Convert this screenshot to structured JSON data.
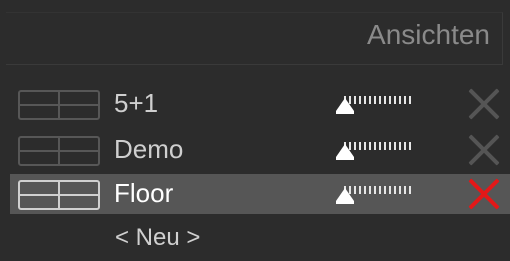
{
  "header": {
    "title": "Ansichten"
  },
  "views": [
    {
      "label": "5+1",
      "selected": false
    },
    {
      "label": "Demo",
      "selected": false
    },
    {
      "label": "Floor",
      "selected": true
    }
  ],
  "new_item_label": "< Neu >",
  "colors": {
    "panel_bg": "#2c2c2c",
    "selected_bg": "#565656",
    "delete_active": "#e31818",
    "delete_inactive": "#555555"
  },
  "icons": {
    "layout": "grid-2x2-icon",
    "delete": "close-icon",
    "slider": "slider-handle-icon"
  }
}
